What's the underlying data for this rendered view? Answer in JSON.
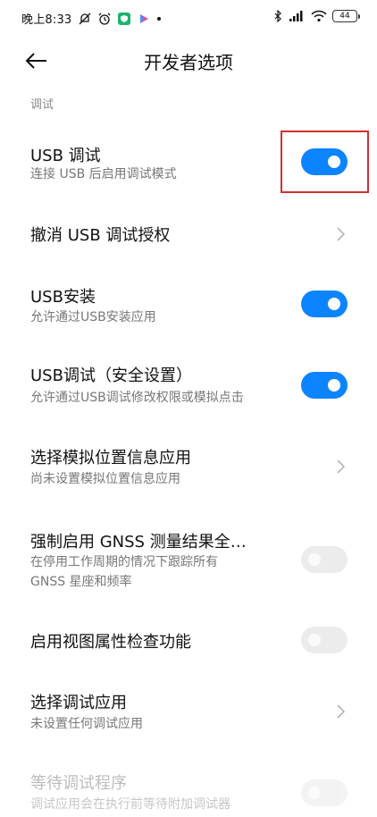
{
  "status_bar": {
    "time": "晚上8:33",
    "battery": "44"
  },
  "header": {
    "title": "开发者选项"
  },
  "section": {
    "label": "调试"
  },
  "colors": {
    "accent": "#0d84ff",
    "highlight": "#d32f2f"
  },
  "items": [
    {
      "title": "USB 调试",
      "subtitle": "连接 USB 后启用调试模式",
      "control": "toggle",
      "on": true
    },
    {
      "title": "撤消 USB 调试授权",
      "subtitle": "",
      "control": "chevron"
    },
    {
      "title": "USB安装",
      "subtitle": "允许通过USB安装应用",
      "control": "toggle",
      "on": true
    },
    {
      "title": "USB调试（安全设置）",
      "subtitle": "允许通过USB调试修改权限或模拟点击",
      "control": "toggle",
      "on": true
    },
    {
      "title": "选择模拟位置信息应用",
      "subtitle": "尚未设置模拟位置信息应用",
      "control": "chevron"
    },
    {
      "title": "强制启用 GNSS 测量结果全…",
      "subtitle": "在停用工作周期的情况下跟踪所有",
      "subtitle2": "GNSS 星座和频率",
      "control": "toggle",
      "on": false
    },
    {
      "title": "启用视图属性检查功能",
      "subtitle": "",
      "control": "toggle",
      "on": false
    },
    {
      "title": "选择调试应用",
      "subtitle": "未设置任何调试应用",
      "control": "chevron"
    },
    {
      "title": "等待调试程序",
      "subtitle": "调试应用会在执行前等待附加调试器",
      "control": "toggle",
      "on": false,
      "disabled": true
    }
  ]
}
